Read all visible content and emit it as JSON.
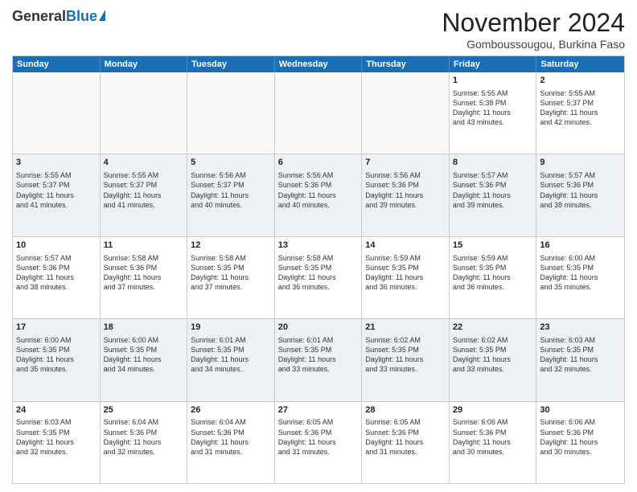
{
  "logo": {
    "general": "General",
    "blue": "Blue"
  },
  "header": {
    "month": "November 2024",
    "location": "Gomboussougou, Burkina Faso"
  },
  "days_of_week": [
    "Sunday",
    "Monday",
    "Tuesday",
    "Wednesday",
    "Thursday",
    "Friday",
    "Saturday"
  ],
  "rows": [
    [
      {
        "day": "",
        "lines": []
      },
      {
        "day": "",
        "lines": []
      },
      {
        "day": "",
        "lines": []
      },
      {
        "day": "",
        "lines": []
      },
      {
        "day": "",
        "lines": []
      },
      {
        "day": "1",
        "lines": [
          "Sunrise: 5:55 AM",
          "Sunset: 5:38 PM",
          "Daylight: 11 hours",
          "and 43 minutes."
        ]
      },
      {
        "day": "2",
        "lines": [
          "Sunrise: 5:55 AM",
          "Sunset: 5:37 PM",
          "Daylight: 11 hours",
          "and 42 minutes."
        ]
      }
    ],
    [
      {
        "day": "3",
        "lines": [
          "Sunrise: 5:55 AM",
          "Sunset: 5:37 PM",
          "Daylight: 11 hours",
          "and 41 minutes."
        ]
      },
      {
        "day": "4",
        "lines": [
          "Sunrise: 5:55 AM",
          "Sunset: 5:37 PM",
          "Daylight: 11 hours",
          "and 41 minutes."
        ]
      },
      {
        "day": "5",
        "lines": [
          "Sunrise: 5:56 AM",
          "Sunset: 5:37 PM",
          "Daylight: 11 hours",
          "and 40 minutes."
        ]
      },
      {
        "day": "6",
        "lines": [
          "Sunrise: 5:56 AM",
          "Sunset: 5:36 PM",
          "Daylight: 11 hours",
          "and 40 minutes."
        ]
      },
      {
        "day": "7",
        "lines": [
          "Sunrise: 5:56 AM",
          "Sunset: 5:36 PM",
          "Daylight: 11 hours",
          "and 39 minutes."
        ]
      },
      {
        "day": "8",
        "lines": [
          "Sunrise: 5:57 AM",
          "Sunset: 5:36 PM",
          "Daylight: 11 hours",
          "and 39 minutes."
        ]
      },
      {
        "day": "9",
        "lines": [
          "Sunrise: 5:57 AM",
          "Sunset: 5:36 PM",
          "Daylight: 11 hours",
          "and 38 minutes."
        ]
      }
    ],
    [
      {
        "day": "10",
        "lines": [
          "Sunrise: 5:57 AM",
          "Sunset: 5:36 PM",
          "Daylight: 11 hours",
          "and 38 minutes."
        ]
      },
      {
        "day": "11",
        "lines": [
          "Sunrise: 5:58 AM",
          "Sunset: 5:36 PM",
          "Daylight: 11 hours",
          "and 37 minutes."
        ]
      },
      {
        "day": "12",
        "lines": [
          "Sunrise: 5:58 AM",
          "Sunset: 5:35 PM",
          "Daylight: 11 hours",
          "and 37 minutes."
        ]
      },
      {
        "day": "13",
        "lines": [
          "Sunrise: 5:58 AM",
          "Sunset: 5:35 PM",
          "Daylight: 11 hours",
          "and 36 minutes."
        ]
      },
      {
        "day": "14",
        "lines": [
          "Sunrise: 5:59 AM",
          "Sunset: 5:35 PM",
          "Daylight: 11 hours",
          "and 36 minutes."
        ]
      },
      {
        "day": "15",
        "lines": [
          "Sunrise: 5:59 AM",
          "Sunset: 5:35 PM",
          "Daylight: 11 hours",
          "and 36 minutes."
        ]
      },
      {
        "day": "16",
        "lines": [
          "Sunrise: 6:00 AM",
          "Sunset: 5:35 PM",
          "Daylight: 11 hours",
          "and 35 minutes."
        ]
      }
    ],
    [
      {
        "day": "17",
        "lines": [
          "Sunrise: 6:00 AM",
          "Sunset: 5:35 PM",
          "Daylight: 11 hours",
          "and 35 minutes."
        ]
      },
      {
        "day": "18",
        "lines": [
          "Sunrise: 6:00 AM",
          "Sunset: 5:35 PM",
          "Daylight: 11 hours",
          "and 34 minutes."
        ]
      },
      {
        "day": "19",
        "lines": [
          "Sunrise: 6:01 AM",
          "Sunset: 5:35 PM",
          "Daylight: 11 hours",
          "and 34 minutes."
        ]
      },
      {
        "day": "20",
        "lines": [
          "Sunrise: 6:01 AM",
          "Sunset: 5:35 PM",
          "Daylight: 11 hours",
          "and 33 minutes."
        ]
      },
      {
        "day": "21",
        "lines": [
          "Sunrise: 6:02 AM",
          "Sunset: 5:35 PM",
          "Daylight: 11 hours",
          "and 33 minutes."
        ]
      },
      {
        "day": "22",
        "lines": [
          "Sunrise: 6:02 AM",
          "Sunset: 5:35 PM",
          "Daylight: 11 hours",
          "and 33 minutes."
        ]
      },
      {
        "day": "23",
        "lines": [
          "Sunrise: 6:03 AM",
          "Sunset: 5:35 PM",
          "Daylight: 11 hours",
          "and 32 minutes."
        ]
      }
    ],
    [
      {
        "day": "24",
        "lines": [
          "Sunrise: 6:03 AM",
          "Sunset: 5:35 PM",
          "Daylight: 11 hours",
          "and 32 minutes."
        ]
      },
      {
        "day": "25",
        "lines": [
          "Sunrise: 6:04 AM",
          "Sunset: 5:36 PM",
          "Daylight: 11 hours",
          "and 32 minutes."
        ]
      },
      {
        "day": "26",
        "lines": [
          "Sunrise: 6:04 AM",
          "Sunset: 5:36 PM",
          "Daylight: 11 hours",
          "and 31 minutes."
        ]
      },
      {
        "day": "27",
        "lines": [
          "Sunrise: 6:05 AM",
          "Sunset: 5:36 PM",
          "Daylight: 11 hours",
          "and 31 minutes."
        ]
      },
      {
        "day": "28",
        "lines": [
          "Sunrise: 6:05 AM",
          "Sunset: 5:36 PM",
          "Daylight: 11 hours",
          "and 31 minutes."
        ]
      },
      {
        "day": "29",
        "lines": [
          "Sunrise: 6:06 AM",
          "Sunset: 5:36 PM",
          "Daylight: 11 hours",
          "and 30 minutes."
        ]
      },
      {
        "day": "30",
        "lines": [
          "Sunrise: 6:06 AM",
          "Sunset: 5:36 PM",
          "Daylight: 11 hours",
          "and 30 minutes."
        ]
      }
    ]
  ]
}
